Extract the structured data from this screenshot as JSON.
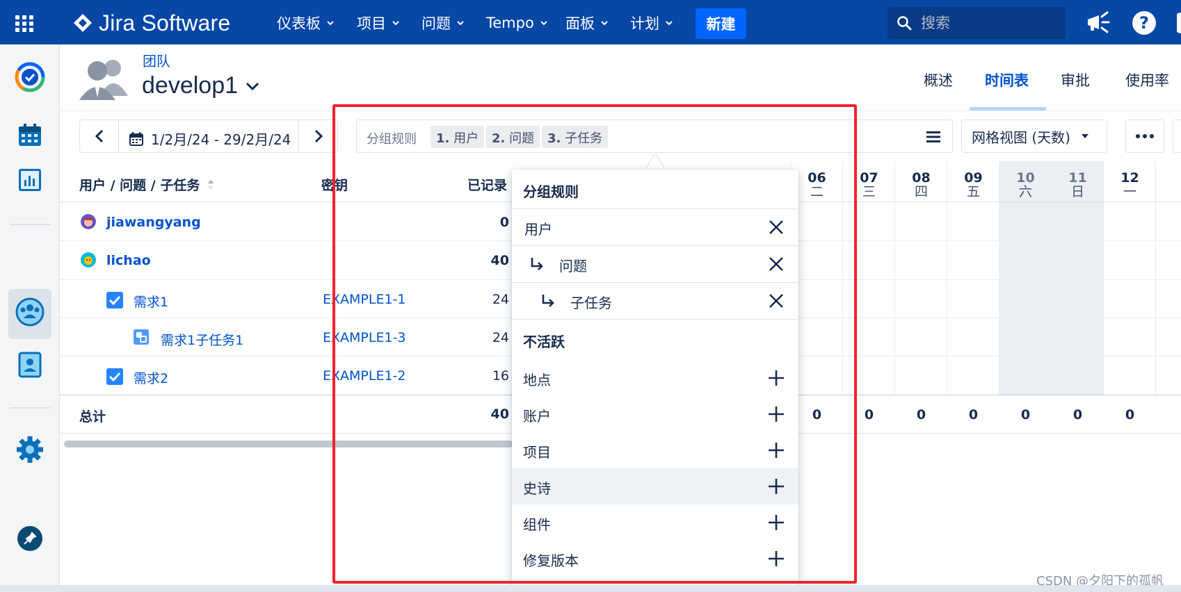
{
  "topnav": {
    "logo_text": "Jira Software",
    "menu": [
      {
        "label": "仪表板"
      },
      {
        "label": "项目"
      },
      {
        "label": "问题"
      },
      {
        "label": "Tempo"
      },
      {
        "label": "面板"
      },
      {
        "label": "计划"
      }
    ],
    "create_label": "新建",
    "search_placeholder": "搜索",
    "brand_color": "#0747a6",
    "accent_color": "#0065ff"
  },
  "sidebar": {
    "icons": [
      "tempo-logo-icon",
      "calendar-icon",
      "reports-icon",
      "team-icon",
      "user-card-icon",
      "settings-icon",
      "pin-icon"
    ]
  },
  "header": {
    "team_label": "团队",
    "team_name": "develop1",
    "tabs": [
      {
        "label": "概述"
      },
      {
        "label": "时间表"
      },
      {
        "label": "审批"
      },
      {
        "label": "使用率"
      }
    ]
  },
  "toolbar": {
    "date_range": "1/2月/24 - 29/2月/24",
    "grouping_label": "分组规则",
    "chips": [
      {
        "num": "1.",
        "label": "用户"
      },
      {
        "num": "2.",
        "label": "问题"
      },
      {
        "num": "3.",
        "label": "子任务"
      }
    ],
    "view_select": "网格视图 (天数)"
  },
  "table": {
    "headers": {
      "name": "用户 / 问题 / 子任务",
      "key": "密钥",
      "logged": "已记录"
    },
    "rows": [
      {
        "name": "jiawangyang",
        "key": "",
        "logged": "0",
        "type": "user"
      },
      {
        "name": "lichao",
        "key": "",
        "logged": "40",
        "type": "user"
      },
      {
        "name": "需求1",
        "key": "EXAMPLE1-1",
        "logged": "24",
        "type": "issue"
      },
      {
        "name": "需求1子任务1",
        "key": "EXAMPLE1-3",
        "logged": "24",
        "type": "subtask"
      },
      {
        "name": "需求2",
        "key": "EXAMPLE1-2",
        "logged": "16",
        "type": "issue"
      }
    ],
    "total_label": "总计",
    "total_value": "40",
    "days": [
      {
        "date": "06",
        "weekday": "二",
        "total": "0",
        "weekend": false
      },
      {
        "date": "07",
        "weekday": "三",
        "total": "0",
        "weekend": false
      },
      {
        "date": "08",
        "weekday": "四",
        "total": "0",
        "weekend": false
      },
      {
        "date": "09",
        "weekday": "五",
        "total": "0",
        "weekend": false
      },
      {
        "date": "10",
        "weekday": "六",
        "total": "0",
        "weekend": true
      },
      {
        "date": "11",
        "weekday": "日",
        "total": "0",
        "weekend": true
      },
      {
        "date": "12",
        "weekday": "一",
        "total": "0",
        "weekend": false
      }
    ]
  },
  "popover": {
    "title": "分组规则",
    "active": [
      {
        "label": "用户"
      },
      {
        "label": "问题"
      },
      {
        "label": "子任务"
      }
    ],
    "inactive_title": "不活跃",
    "inactive": [
      {
        "label": "地点"
      },
      {
        "label": "账户"
      },
      {
        "label": "项目"
      },
      {
        "label": "史诗"
      },
      {
        "label": "组件"
      },
      {
        "label": "修复版本"
      }
    ]
  },
  "watermark": "CSDN @夕阳下的孤帆"
}
